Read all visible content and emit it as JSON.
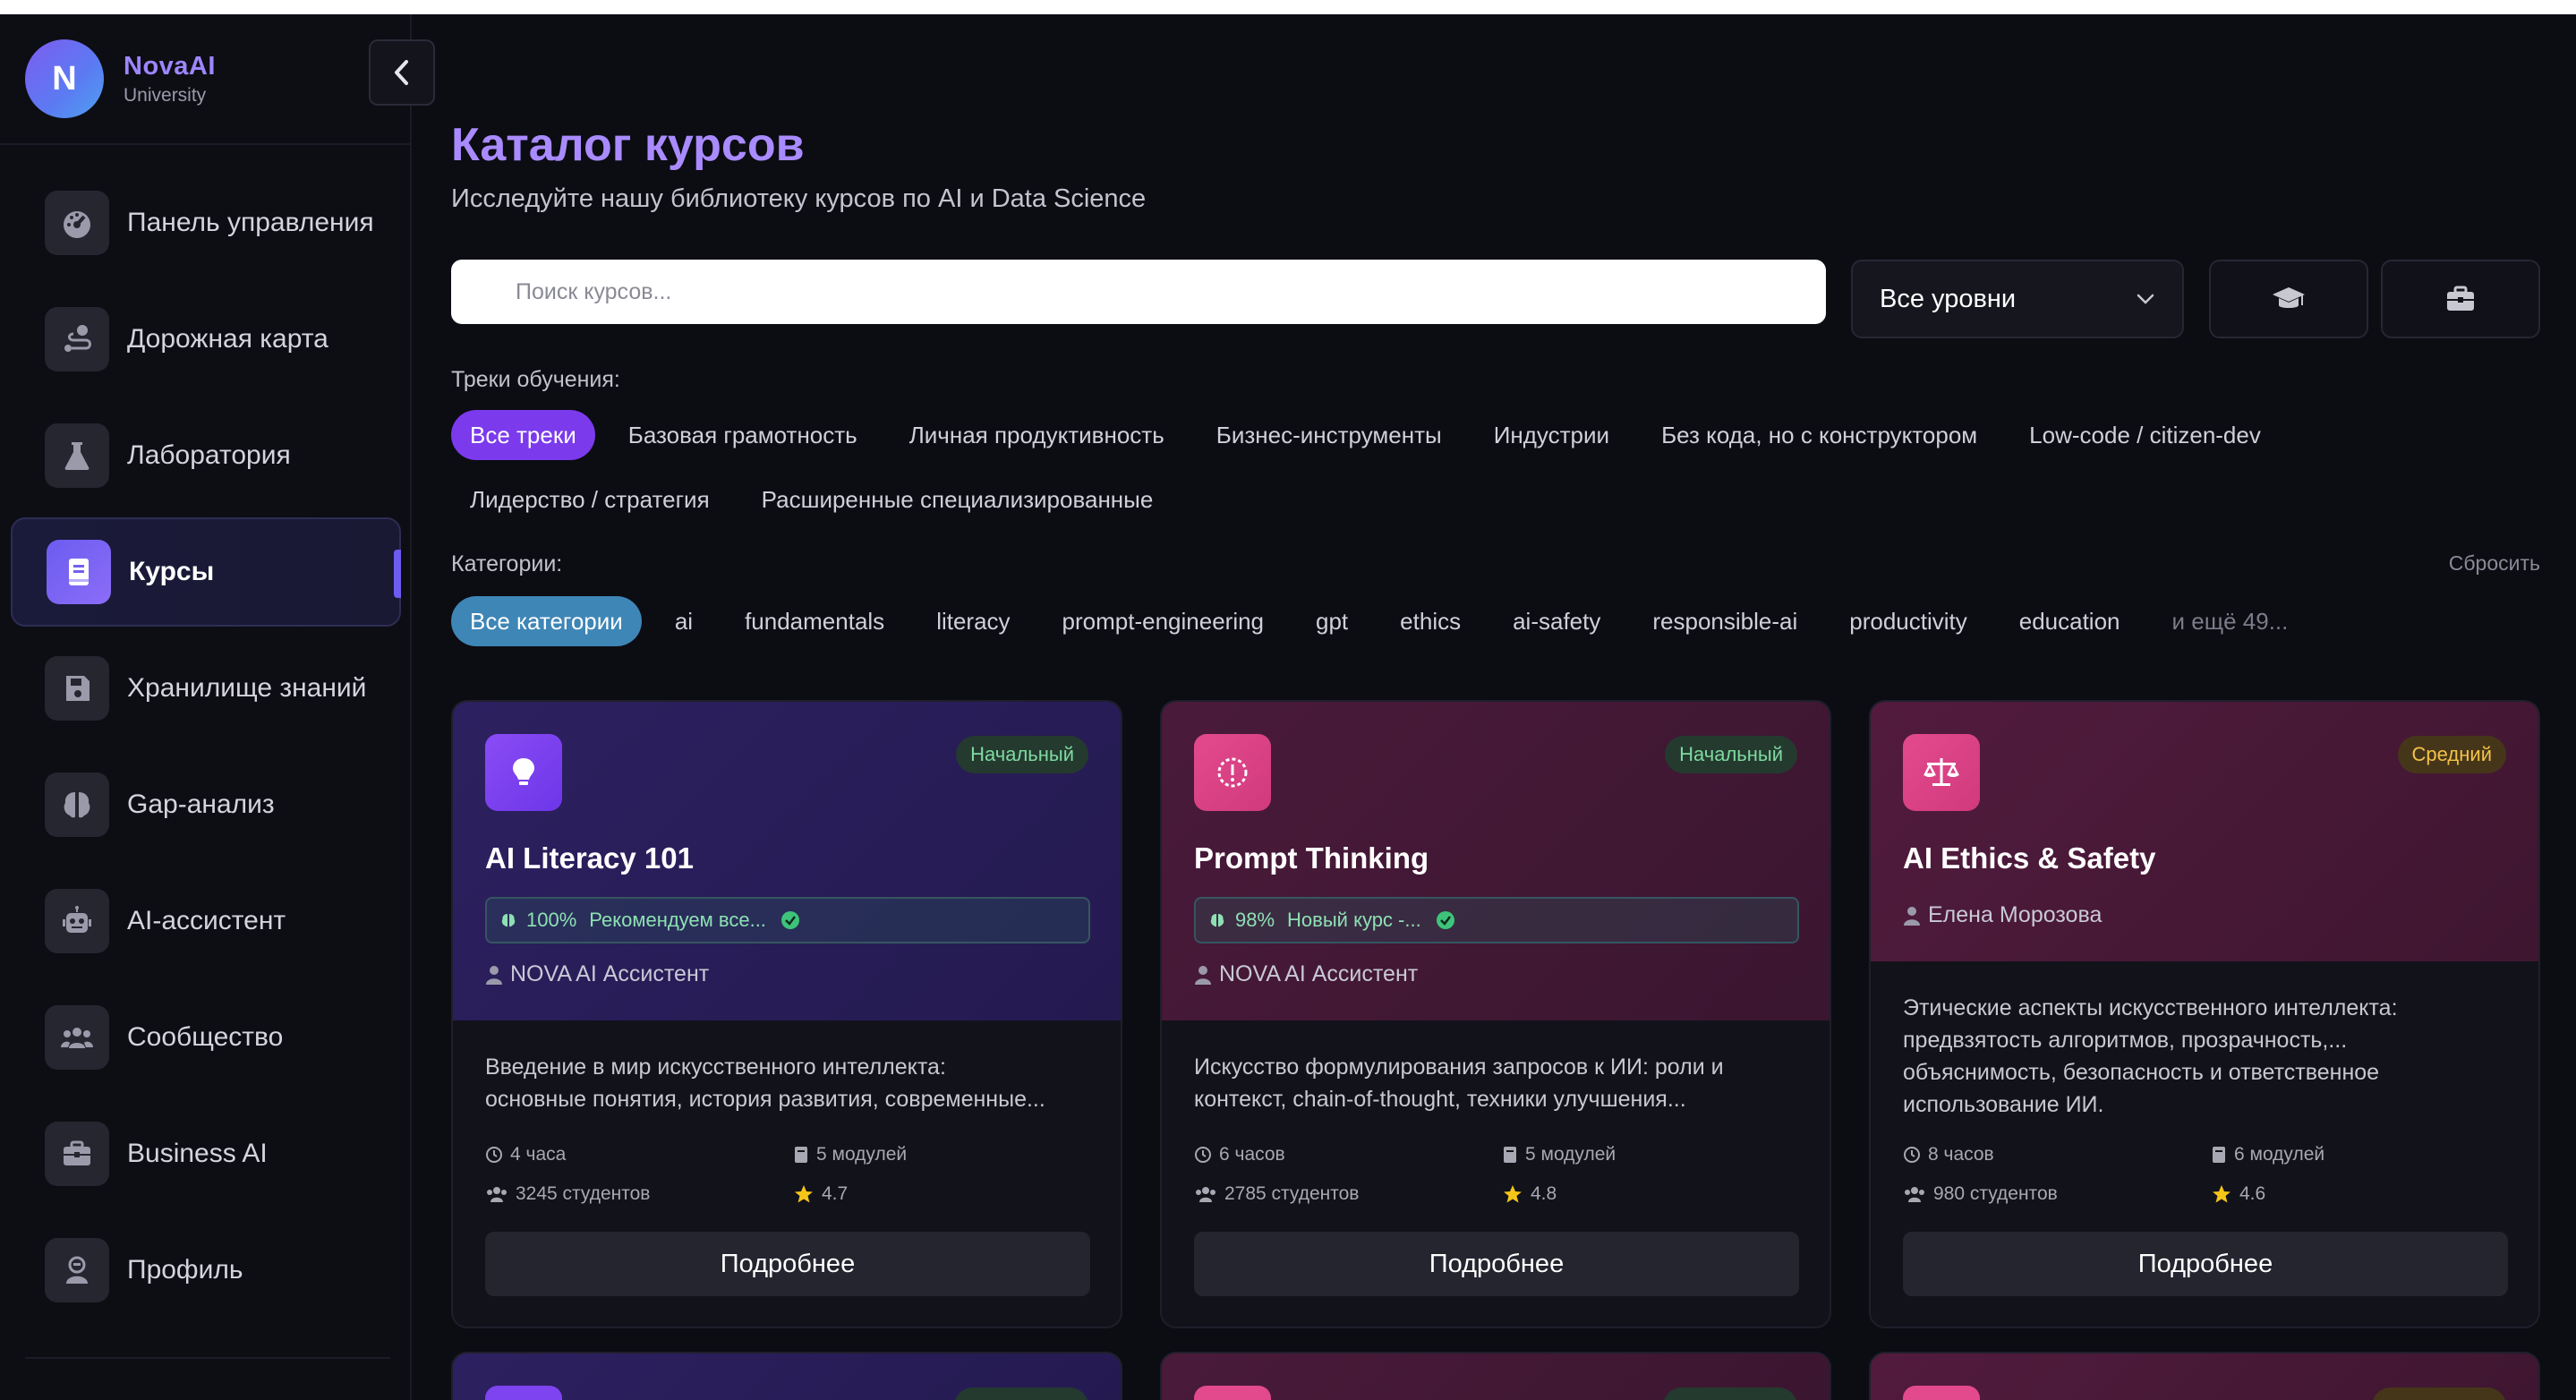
{
  "brand": {
    "initial": "N",
    "name": "NovaAI",
    "sub": "University"
  },
  "sidebar": {
    "items": [
      {
        "label": "Панель управления",
        "icon": "dashboard-icon"
      },
      {
        "label": "Дорожная карта",
        "icon": "route-icon"
      },
      {
        "label": "Лаборатория",
        "icon": "flask-icon"
      },
      {
        "label": "Курсы",
        "icon": "book-icon",
        "active": true
      },
      {
        "label": "Хранилище знаний",
        "icon": "save-icon"
      },
      {
        "label": "Gap-анализ",
        "icon": "brain-icon"
      },
      {
        "label": "AI-ассистент",
        "icon": "robot-icon"
      },
      {
        "label": "Сообщество",
        "icon": "users-icon"
      },
      {
        "label": "Business AI",
        "icon": "briefcase-icon"
      },
      {
        "label": "Профиль",
        "icon": "user-icon"
      }
    ]
  },
  "header": {
    "title": "Каталог курсов",
    "subtitle": "Исследуйте нашу библиотеку курсов по AI и Data Science"
  },
  "search": {
    "placeholder": "Поиск курсов...",
    "value": ""
  },
  "level_select": {
    "value": "Все уровни"
  },
  "tracks": {
    "label": "Треки обучения:",
    "items": [
      "Все треки",
      "Базовая грамотность",
      "Личная продуктивность",
      "Бизнес-инструменты",
      "Индустрии",
      "Без кода, но с конструктором",
      "Low-code / citizen-dev",
      "Лидерство / стратегия",
      "Расширенные специализированные"
    ]
  },
  "categories": {
    "label": "Категории:",
    "reset": "Сбросить",
    "items": [
      "Все категории",
      "ai",
      "fundamentals",
      "literacy",
      "prompt-engineering",
      "gpt",
      "ethics",
      "ai-safety",
      "responsible-ai",
      "productivity",
      "education",
      "и ещё 49..."
    ]
  },
  "cards": [
    {
      "title": "AI Literacy 101",
      "level": "Начальный",
      "match": "100%",
      "rec": "Рекомендуем все...",
      "author": "NOVA AI Ассистент",
      "desc_1": "Введение в мир искусственного интеллекта:",
      "desc_2": "основные понятия, история развития, современные...",
      "hours": "4 часа",
      "modules": "5 модулей",
      "students": "3245 студентов",
      "rating": "4.7",
      "button": "Подробнее"
    },
    {
      "title": "Prompt Thinking",
      "level": "Начальный",
      "match": "98%",
      "rec": "Новый курс -...",
      "author": "NOVA AI Ассистент",
      "desc_1": "Искусство формулирования запросов к ИИ: роли и",
      "desc_2": "контекст, chain-of-thought, техники улучшения...",
      "hours": "6 часов",
      "modules": "5 модулей",
      "students": "2785 студентов",
      "rating": "4.8",
      "button": "Подробнее"
    },
    {
      "title": "AI Ethics & Safety",
      "level": "Средний",
      "author": "Елена Морозова",
      "desc_1": "Этические аспекты искусственного интеллекта:",
      "desc_2": "предвзятость алгоритмов, прозрачность,...",
      "desc_3": "объяснимость, безопасность и ответственное",
      "desc_4": "использование ИИ.",
      "hours": "8 часов",
      "modules": "6 модулей",
      "students": "980 студентов",
      "rating": "4.6",
      "button": "Подробнее"
    }
  ],
  "colors": {
    "accent": "#7c3aed",
    "title": "#a98bff",
    "category_active": "#3e86b6",
    "star": "#f5c518"
  }
}
